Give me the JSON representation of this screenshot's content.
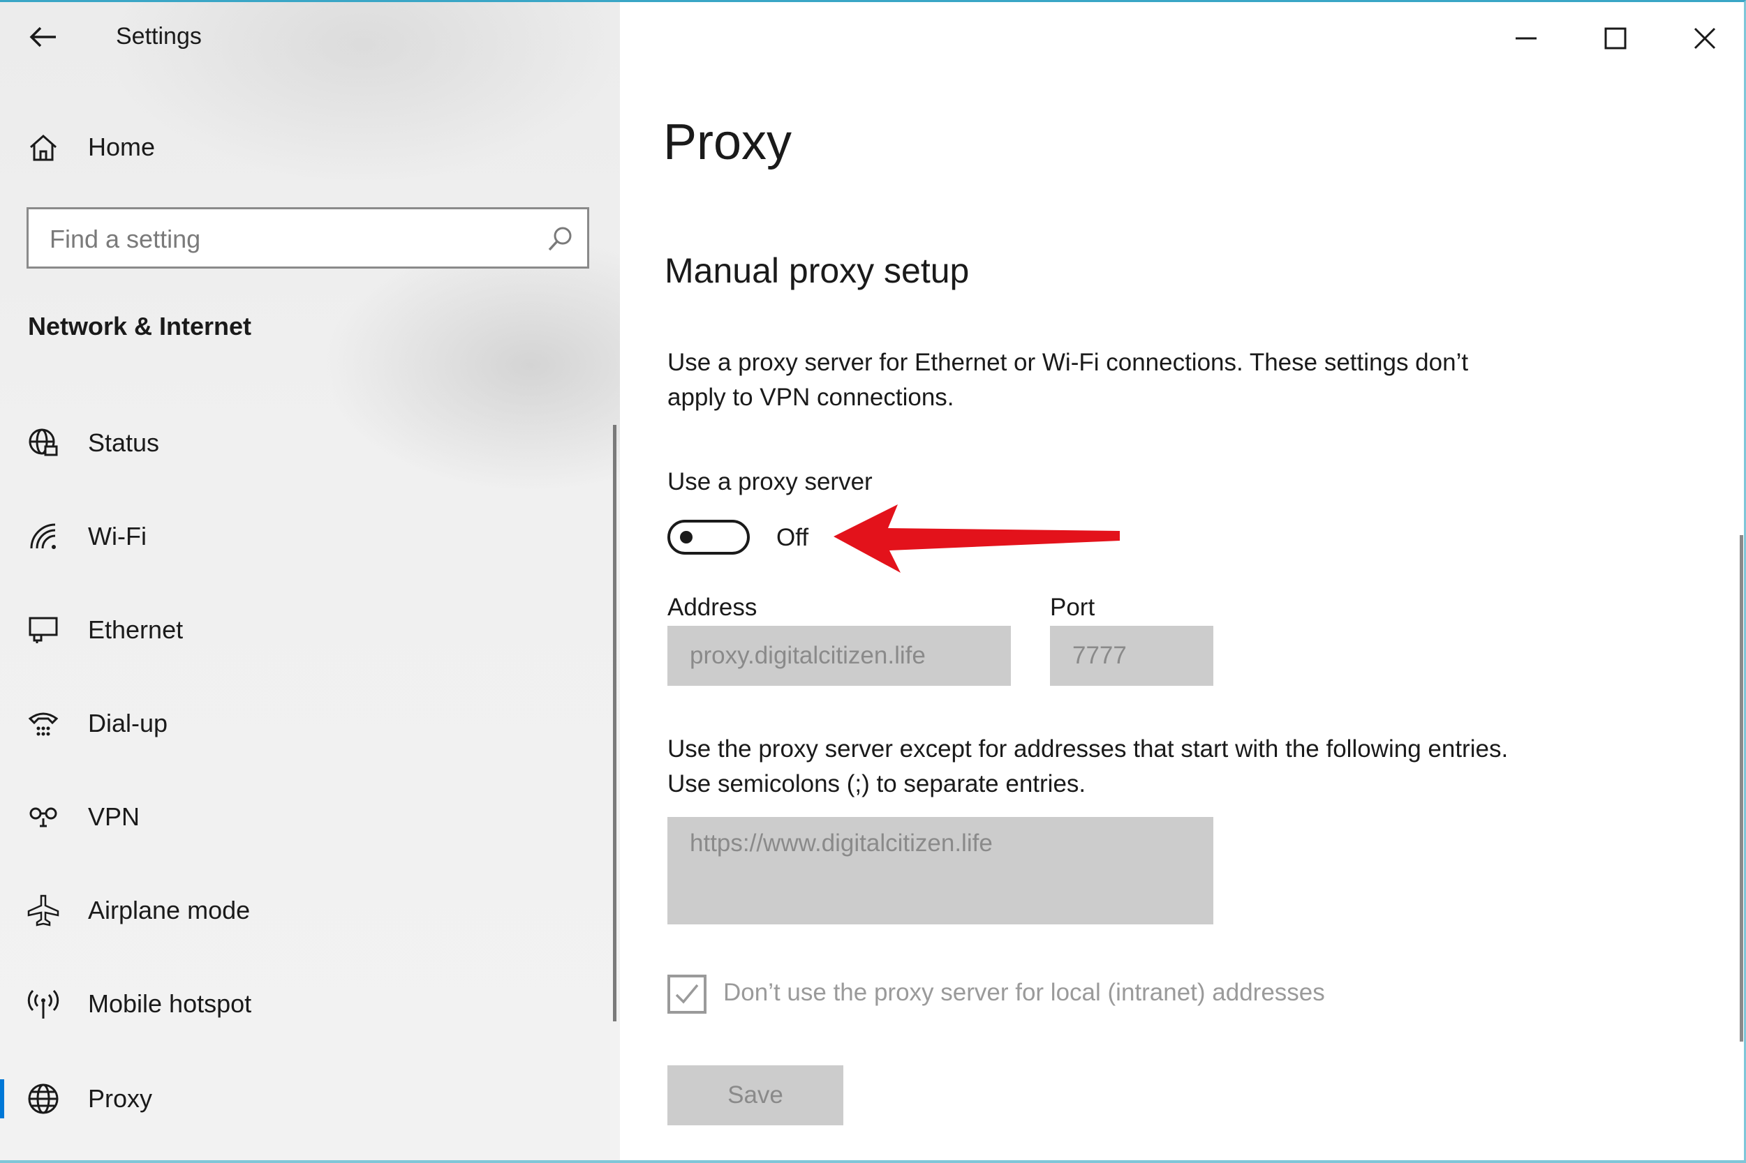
{
  "window": {
    "title": "Settings",
    "controls": {
      "minimize": "minimize-icon",
      "maximize": "maximize-icon",
      "close": "close-icon"
    }
  },
  "sidebar": {
    "home_label": "Home",
    "search": {
      "placeholder": "Find a setting",
      "icon": "search-icon"
    },
    "section_heading": "Network & Internet",
    "items": [
      {
        "label": "Status",
        "icon": "status-globe-icon"
      },
      {
        "label": "Wi-Fi",
        "icon": "wifi-icon"
      },
      {
        "label": "Ethernet",
        "icon": "ethernet-icon"
      },
      {
        "label": "Dial-up",
        "icon": "dialup-icon"
      },
      {
        "label": "VPN",
        "icon": "vpn-icon"
      },
      {
        "label": "Airplane mode",
        "icon": "airplane-icon"
      },
      {
        "label": "Mobile hotspot",
        "icon": "hotspot-icon"
      },
      {
        "label": "Proxy",
        "icon": "globe-icon",
        "selected": true
      }
    ]
  },
  "main": {
    "page_title": "Proxy",
    "section_title": "Manual proxy setup",
    "description": "Use a proxy server for Ethernet or Wi-Fi connections. These settings don’t apply to VPN connections.",
    "use_proxy": {
      "label": "Use a proxy server",
      "state_text": "Off",
      "enabled": false
    },
    "address": {
      "label": "Address",
      "value": "proxy.digitalcitizen.life"
    },
    "port": {
      "label": "Port",
      "value": "7777"
    },
    "exceptions": {
      "description": "Use the proxy server except for addresses that start with the following entries. Use semicolons (;) to separate entries.",
      "value": "https://www.digitalcitizen.life"
    },
    "local_bypass": {
      "label": "Don’t use the proxy server for local (intranet) addresses",
      "checked": true
    },
    "save_label": "Save"
  },
  "colors": {
    "accent": "#0078d7",
    "annotation_arrow": "#e3121b",
    "disabled_field": "#cccccc"
  }
}
